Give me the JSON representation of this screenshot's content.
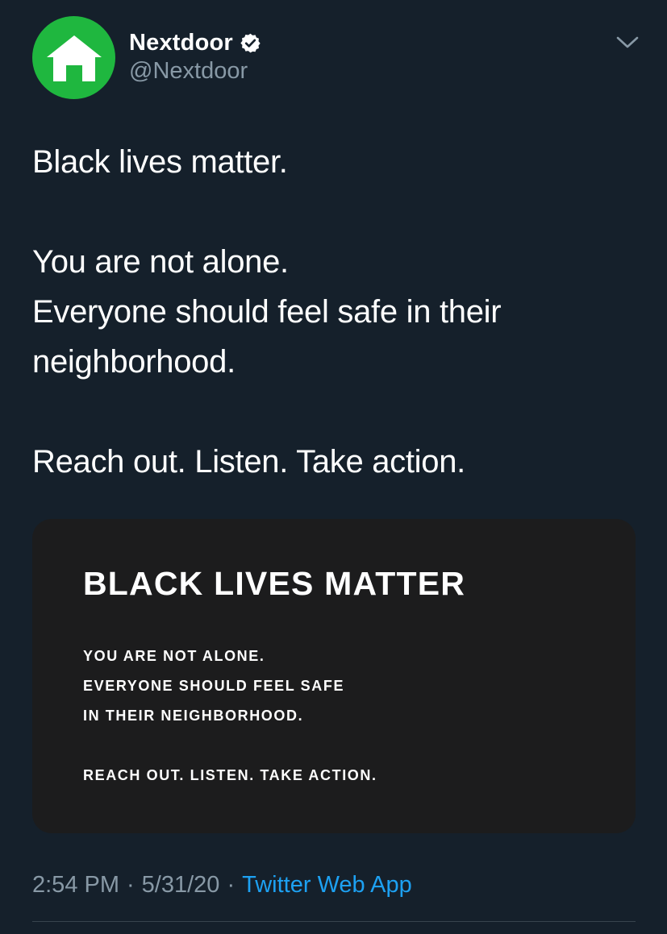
{
  "author": {
    "display_name": "Nextdoor",
    "handle": "@Nextdoor",
    "avatar_icon": "house-icon",
    "avatar_color": "#1fb73f",
    "verified": true
  },
  "tweet": {
    "lines": [
      "Black lives matter.",
      "",
      "You are not alone.",
      "Everyone should feel safe in their",
      "neighborhood.",
      "",
      "Reach out. Listen. Take action."
    ]
  },
  "media": {
    "title": "BLACK LIVES MATTER",
    "lines": [
      "YOU ARE NOT ALONE.",
      "EVERYONE SHOULD FEEL SAFE",
      "IN THEIR NEIGHBORHOOD.",
      "",
      "REACH OUT. LISTEN. TAKE ACTION."
    ],
    "background_color": "#1c1c1d"
  },
  "meta": {
    "time": "2:54 PM",
    "separator": "·",
    "date": "5/31/20",
    "source": "Twitter Web App"
  },
  "theme": {
    "background": "#15202b",
    "secondary_text": "#8899a6",
    "link": "#1da1f2"
  }
}
